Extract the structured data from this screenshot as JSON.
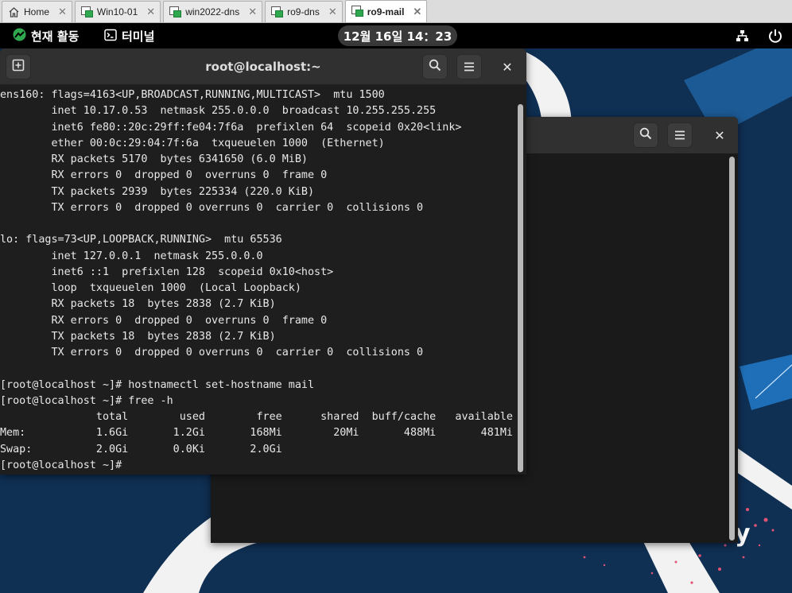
{
  "vm_tabs": [
    {
      "label": "Home",
      "icon": "home-icon",
      "active": false
    },
    {
      "label": "Win10-01",
      "icon": "vm-icon",
      "active": false
    },
    {
      "label": "win2022-dns",
      "icon": "vm-icon",
      "active": false
    },
    {
      "label": "ro9-dns",
      "icon": "vm-icon",
      "active": false
    },
    {
      "label": "ro9-mail",
      "icon": "vm-icon",
      "active": true
    }
  ],
  "topbar": {
    "activities_label": "현재 활동",
    "app_label": "터미널",
    "clock": "12월 16일 14：23"
  },
  "front_window": {
    "title": "root@localhost:~",
    "new_tab_icon": "new-tab-icon",
    "search_icon": "search-icon",
    "menu_icon": "hamburger-menu-icon",
    "close_icon": "close-icon",
    "lines": [
      "ens160: flags=4163<UP,BROADCAST,RUNNING,MULTICAST>  mtu 1500",
      "        inet 10.17.0.53  netmask 255.0.0.0  broadcast 10.255.255.255",
      "        inet6 fe80::20c:29ff:fe04:7f6a  prefixlen 64  scopeid 0x20<link>",
      "        ether 00:0c:29:04:7f:6a  txqueuelen 1000  (Ethernet)",
      "        RX packets 5170  bytes 6341650 (6.0 MiB)",
      "        RX errors 0  dropped 0  overruns 0  frame 0",
      "        TX packets 2939  bytes 225334 (220.0 KiB)",
      "        TX errors 0  dropped 0 overruns 0  carrier 0  collisions 0",
      "",
      "lo: flags=73<UP,LOOPBACK,RUNNING>  mtu 65536",
      "        inet 127.0.0.1  netmask 255.0.0.0",
      "        inet6 ::1  prefixlen 128  scopeid 0x10<host>",
      "        loop  txqueuelen 1000  (Local Loopback)",
      "        RX packets 18  bytes 2838 (2.7 KiB)",
      "        RX errors 0  dropped 0  overruns 0  frame 0",
      "        TX packets 18  bytes 2838 (2.7 KiB)",
      "        TX errors 0  dropped 0 overruns 0  carrier 0  collisions 0",
      "",
      "[root@localhost ~]# hostnamectl set-hostname mail",
      "[root@localhost ~]# free -h",
      "               total        used        free      shared  buff/cache   available",
      "Mem:           1.6Gi       1.2Gi       168Mi        20Mi       488Mi       481Mi",
      "Swap:          2.0Gi       0.0Ki       2.0Gi",
      "[root@localhost ~]# "
    ]
  },
  "back_window": {
    "search_icon": "search-icon",
    "menu_icon": "hamburger-menu-icon",
    "close_icon": "close-icon"
  },
  "colors": {
    "desktop": "#0f2f53",
    "terminal_bg": "#1e1e1e",
    "header_bg": "#303030",
    "topbar_bg": "#000000",
    "accent_green": "#2fa84f"
  }
}
